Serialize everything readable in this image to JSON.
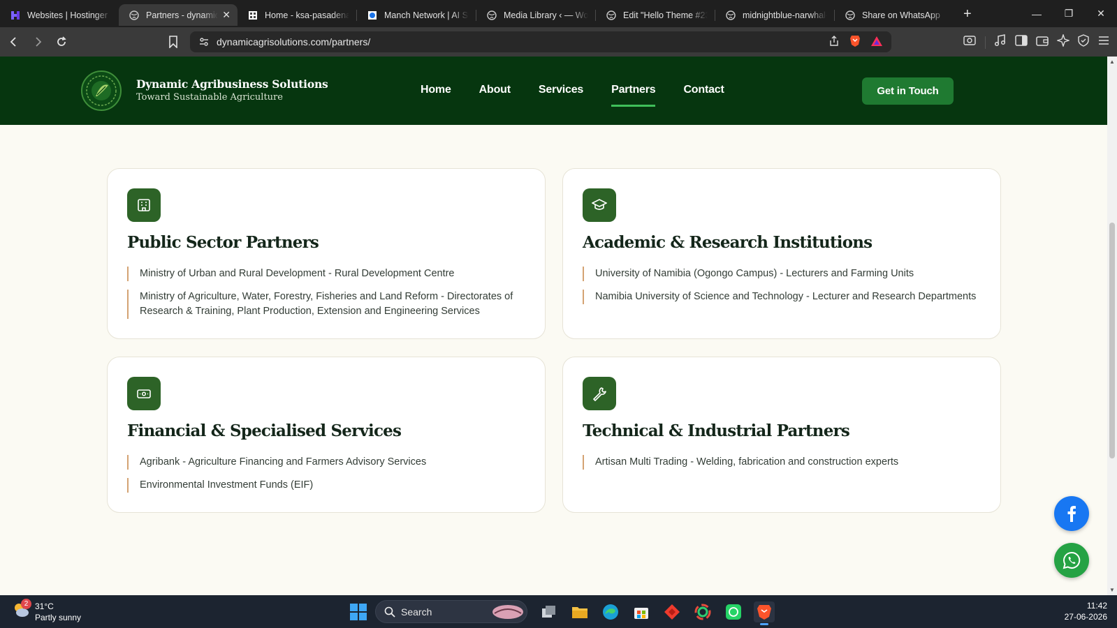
{
  "browser": {
    "tabs": [
      {
        "title": "Websites | Hostinger",
        "active": false
      },
      {
        "title": "Partners - dynamic",
        "active": true
      },
      {
        "title": "Home - ksa-pasadena.c",
        "active": false
      },
      {
        "title": "Manch Network | AI Sy",
        "active": false
      },
      {
        "title": "Media Library ‹ — Wor",
        "active": false
      },
      {
        "title": "Edit \"Hello Theme #23\"",
        "active": false
      },
      {
        "title": "midnightblue-narwhal-",
        "active": false
      },
      {
        "title": "Share on WhatsApp",
        "active": false
      }
    ],
    "url": "dynamicagrisolutions.com/partners/"
  },
  "site": {
    "brand_name": "Dynamic Agribusiness Solutions",
    "brand_tagline": "Toward Sustainable Agriculture",
    "nav": [
      "Home",
      "About",
      "Services",
      "Partners",
      "Contact"
    ],
    "active_nav": "Partners",
    "cta": "Get in Touch"
  },
  "cards": [
    {
      "title": "Public Sector Partners",
      "icon": "building-icon",
      "items": [
        "Ministry of Urban and Rural Development - Rural Development Centre",
        "Ministry of Agriculture, Water, Forestry, Fisheries and Land Reform - Directorates of Research & Training, Plant Production, Extension and Engineering Services"
      ]
    },
    {
      "title": "Academic & Research Institutions",
      "icon": "graduation-cap-icon",
      "items": [
        "University of Namibia (Ogongo Campus) - Lecturers and Farming Units",
        "Namibia University of Science and Technology - Lecturer and Research Departments"
      ]
    },
    {
      "title": "Financial & Specialised Services",
      "icon": "money-icon",
      "items": [
        "Agribank - Agriculture Financing and Farmers Advisory Services",
        "Environmental Investment Funds (EIF)"
      ]
    },
    {
      "title": "Technical & Industrial Partners",
      "icon": "wrench-icon",
      "items": [
        "Artisan Multi Trading - Welding, fabrication and construction experts"
      ]
    }
  ],
  "taskbar": {
    "weather_temp": "31°C",
    "weather_desc": "Partly sunny",
    "weather_badge": "2",
    "search_label": "Search",
    "time": "11:42",
    "date": "27-06-2026"
  },
  "colors": {
    "header_bg": "#06360f",
    "accent_green": "#1f7a31",
    "card_icon_bg": "#2d6327",
    "item_border": "#d4a373"
  }
}
